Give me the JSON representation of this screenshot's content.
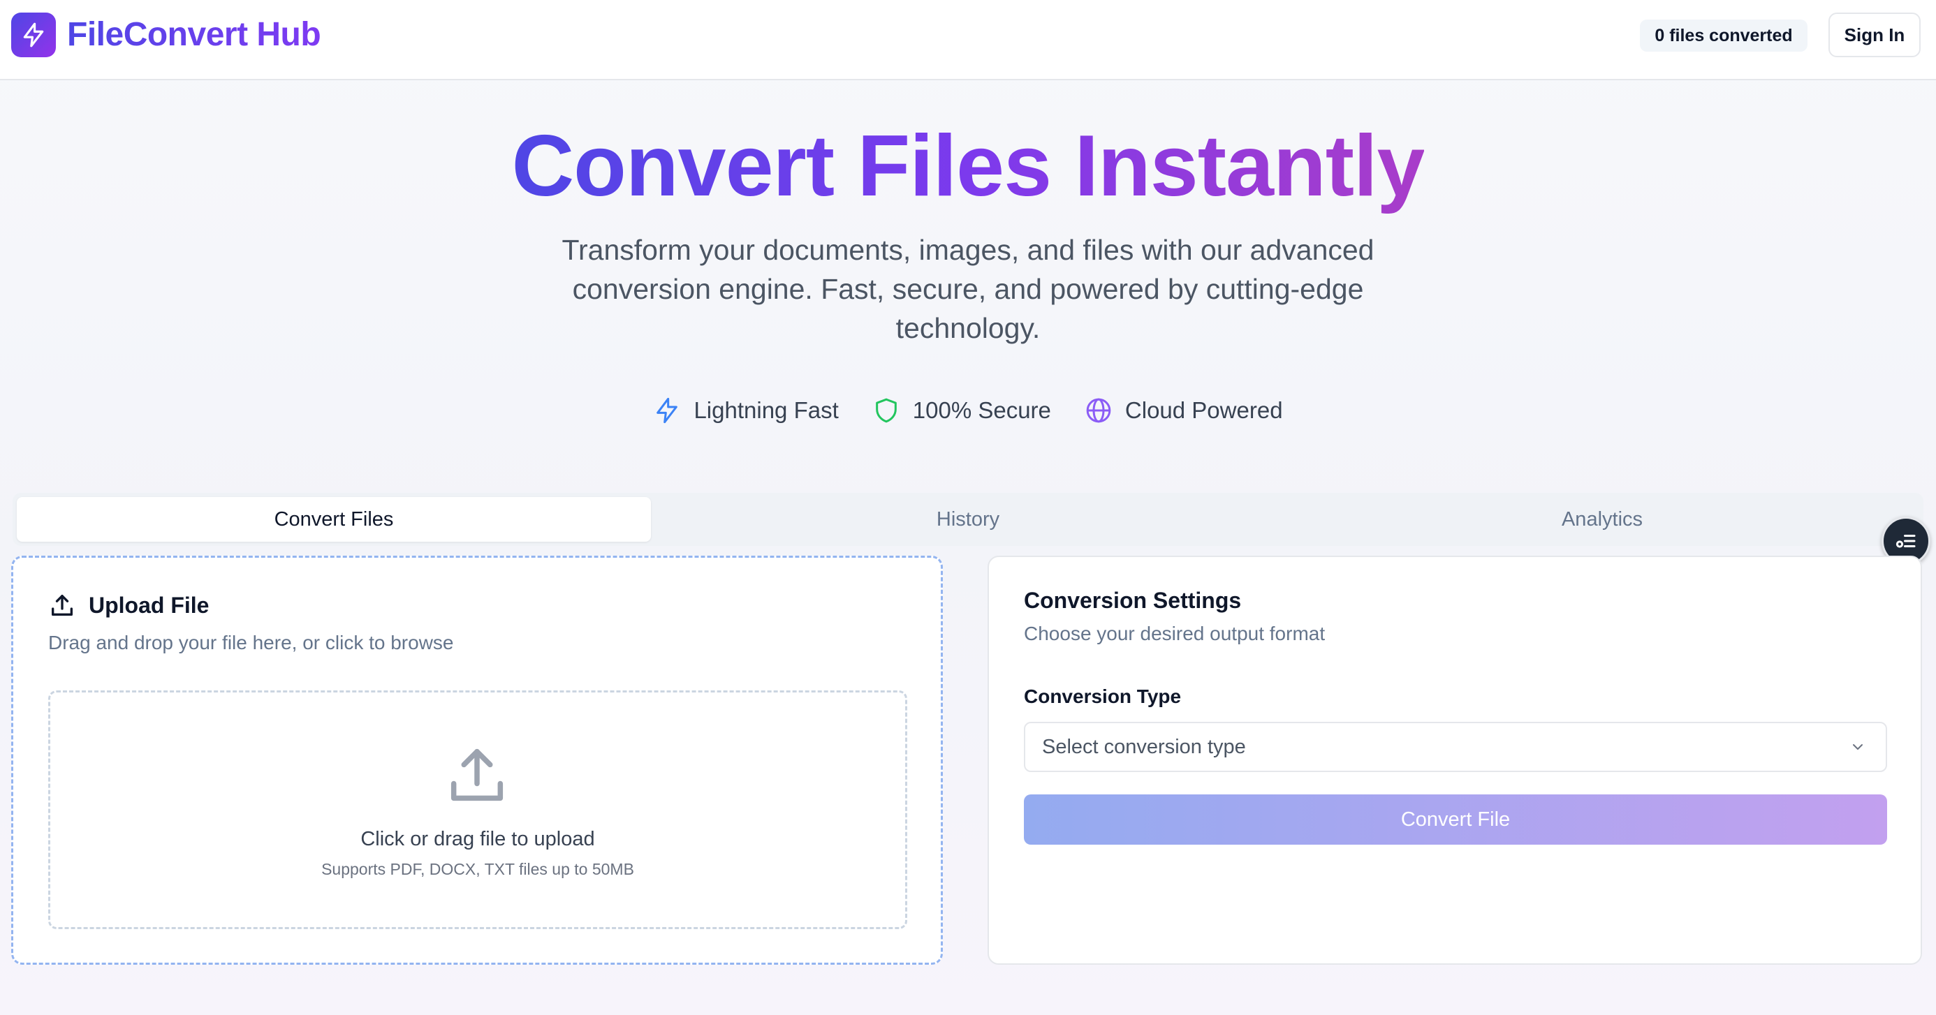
{
  "app": {
    "name": "FileConvert Hub",
    "files_converted_badge": "0 files converted",
    "sign_in_label": "Sign In"
  },
  "hero": {
    "title": "Convert Files Instantly",
    "subtitle": "Transform your documents, images, and files with our advanced conversion engine. Fast, secure, and powered by cutting-edge technology.",
    "features": [
      {
        "label": "Lightning Fast",
        "icon": "lightning-icon",
        "color": "#3b82f6"
      },
      {
        "label": "100% Secure",
        "icon": "shield-icon",
        "color": "#22c55e"
      },
      {
        "label": "Cloud Powered",
        "icon": "globe-icon",
        "color": "#8b5cf6"
      }
    ]
  },
  "tabs": [
    {
      "label": "Convert Files",
      "active": true
    },
    {
      "label": "History",
      "active": false
    },
    {
      "label": "Analytics",
      "active": false
    }
  ],
  "upload": {
    "title": "Upload File",
    "description": "Drag and drop your file here, or click to browse",
    "dropzone_text": "Click or drag file to upload",
    "dropzone_hint": "Supports PDF, DOCX, TXT files up to 50MB"
  },
  "settings": {
    "title": "Conversion Settings",
    "description": "Choose your desired output format",
    "field_label": "Conversion Type",
    "select_placeholder": "Select conversion type",
    "convert_button": "Convert File"
  },
  "colors": {
    "brand_start": "#4f46e5",
    "brand_end": "#9333ea",
    "upload_border": "#93b4f0"
  }
}
